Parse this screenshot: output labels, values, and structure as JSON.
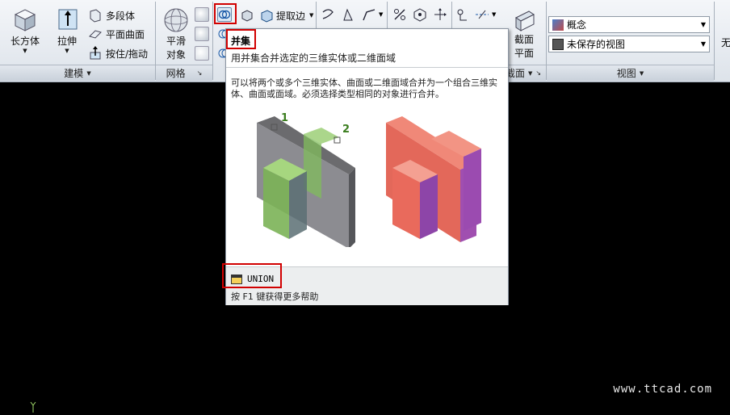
{
  "ribbon": {
    "modeling": {
      "box_label": "长方体",
      "extrude_label": "拉伸",
      "polysolid_label": "多段体",
      "planar_surface_label": "平面曲面",
      "presspull_label": "按住/拖动",
      "panel_title": "建模"
    },
    "mesh": {
      "smooth_label_1": "平滑",
      "smooth_label_2": "对象",
      "panel_title": "网格"
    },
    "solid_edit": {
      "extract_edges_label": "提取边"
    },
    "section": {
      "section_plane_label_1": "截面",
      "section_plane_label_2": "平面",
      "panel_title": "截面"
    },
    "view": {
      "visual_style": "概念",
      "named_view": "未保存的视图",
      "panel_title": "视图",
      "cutoff_label": "无"
    }
  },
  "tooltip": {
    "title": "并集",
    "subtitle": "用并集合并选定的三维实体或二维面域",
    "description": "可以将两个或多个三维实体、曲面或二维面域合并为一个组合三维实体、曲面或面域。必须选择类型相同的对象进行合并。",
    "label_1": "1",
    "label_2": "2",
    "command": "UNION",
    "help": "按 F1 键获得更多帮助"
  },
  "watermark": "www.ttcad.com"
}
